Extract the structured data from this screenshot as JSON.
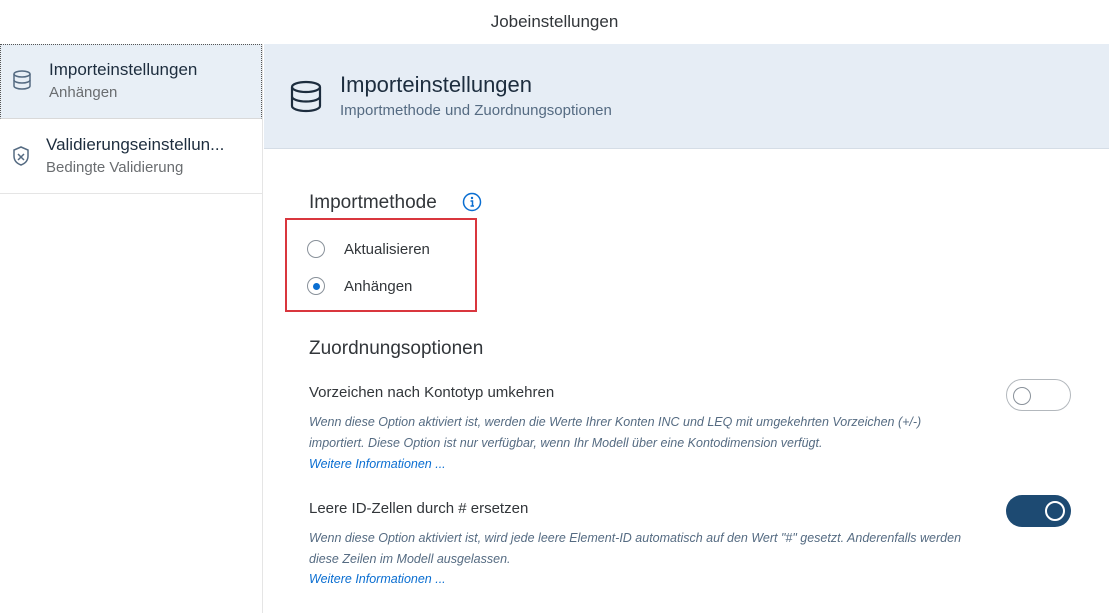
{
  "window": {
    "title": "Jobeinstellungen"
  },
  "sidebar": {
    "items": [
      {
        "title": "Importeinstellungen",
        "subtitle": "Anhängen",
        "icon": "database-icon",
        "selected": true
      },
      {
        "title": "Validierungseinstellun...",
        "subtitle": "Bedingte Validierung",
        "icon": "shield-check-icon",
        "selected": false
      }
    ]
  },
  "header": {
    "title": "Importeinstellungen",
    "subtitle": "Importmethode und Zuordnungsoptionen",
    "icon": "database-icon"
  },
  "import_method": {
    "title": "Importmethode",
    "info_icon": "info-icon",
    "options": [
      {
        "label": "Aktualisieren",
        "checked": false
      },
      {
        "label": "Anhängen",
        "checked": true
      }
    ],
    "highlight_color": "#d9363e"
  },
  "mapping": {
    "title": "Zuordnungsoptionen",
    "options": [
      {
        "title": "Vorzeichen nach Kontotyp umkehren",
        "description": "Wenn diese Option aktiviert ist, werden die Werte Ihrer Konten INC und LEQ mit umgekehrten Vorzeichen (+/-) importiert. Diese Option ist nur verfügbar, wenn Ihr Modell über eine Kontodimension verfügt.",
        "link": "Weitere Informationen ...",
        "enabled": false
      },
      {
        "title": "Leere ID-Zellen durch # ersetzen",
        "description": "Wenn diese Option aktiviert ist, wird jede leere Element-ID automatisch auf den Wert \"#\" gesetzt. Anderenfalls werden diese Zeilen im Modell ausgelassen.",
        "link": "Weitere Informationen ...",
        "enabled": true
      }
    ]
  },
  "colors": {
    "accent": "#0a6ed1",
    "switch_on": "#1d4a72",
    "header_bg": "#e6edf5",
    "selected_bg": "#e8eff6"
  }
}
